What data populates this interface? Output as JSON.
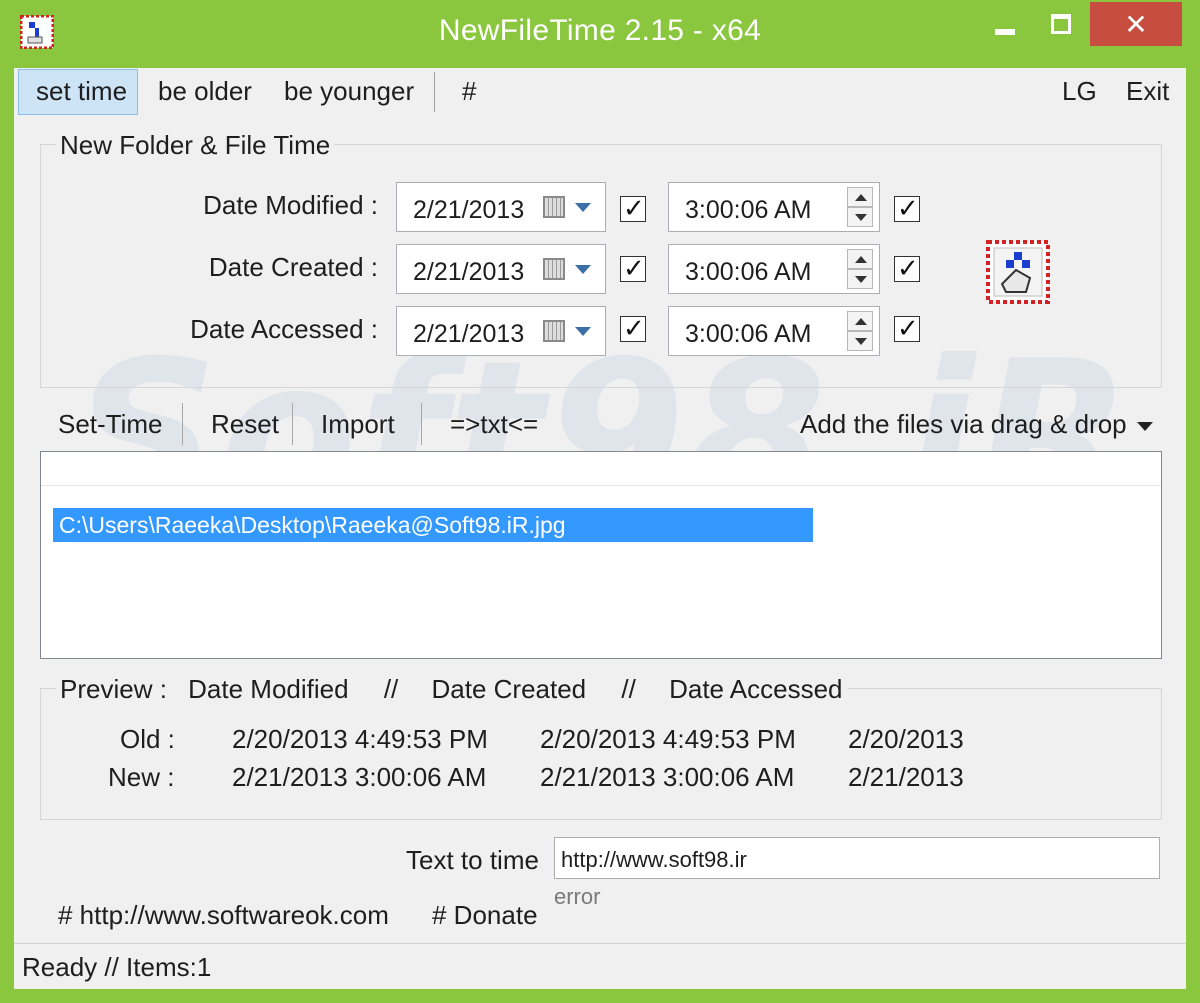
{
  "window": {
    "title": "NewFileTime 2.15 - x64",
    "close_glyph": "✕",
    "accent_color": "#8bc63f"
  },
  "menu": {
    "items": [
      "set time",
      "be older",
      "be younger",
      "#"
    ],
    "right": [
      "LG",
      "Exit"
    ],
    "selected": "set time"
  },
  "group": {
    "title": "New Folder & File Time",
    "rows": [
      {
        "label": "Date Modified :",
        "date": "2/21/2013",
        "time": "3:00:06 AM",
        "date_checked": true,
        "time_checked": true
      },
      {
        "label": "Date Created :",
        "date": "2/21/2013",
        "time": "3:00:06 AM",
        "date_checked": true,
        "time_checked": true
      },
      {
        "label": "Date Accessed :",
        "date": "2/21/2013",
        "time": "3:00:06 AM",
        "date_checked": true,
        "time_checked": true
      }
    ],
    "check_glyph": "✓"
  },
  "toolbar": {
    "set_time": "Set-Time",
    "reset": "Reset",
    "import": "Import",
    "txt": "=>txt<=",
    "drag_drop": "Add the files via drag & drop"
  },
  "file_list": {
    "items": [
      "C:\\Users\\Raeeka\\Desktop\\Raeeka@Soft98.iR.jpg"
    ]
  },
  "preview": {
    "heading": "Preview :",
    "columns": [
      "Date Modified",
      "Date Created",
      "Date Accessed"
    ],
    "separator": "//",
    "old_label": "Old :",
    "new_label": "New :",
    "old": [
      "2/20/2013 4:49:53 PM",
      "2/20/2013 4:49:53 PM",
      "2/20/2013"
    ],
    "new": [
      "2/21/2013 3:00:06 AM",
      "2/21/2013 3:00:06 AM",
      "2/21/2013"
    ]
  },
  "text_to_time": {
    "label": "Text to time",
    "value": "http://www.soft98.ir",
    "status": "error"
  },
  "footer": {
    "website": "# http://www.softwareok.com",
    "donate": "# Donate"
  },
  "status_bar": "Ready // Items:1",
  "watermark": "Soft98.iR"
}
